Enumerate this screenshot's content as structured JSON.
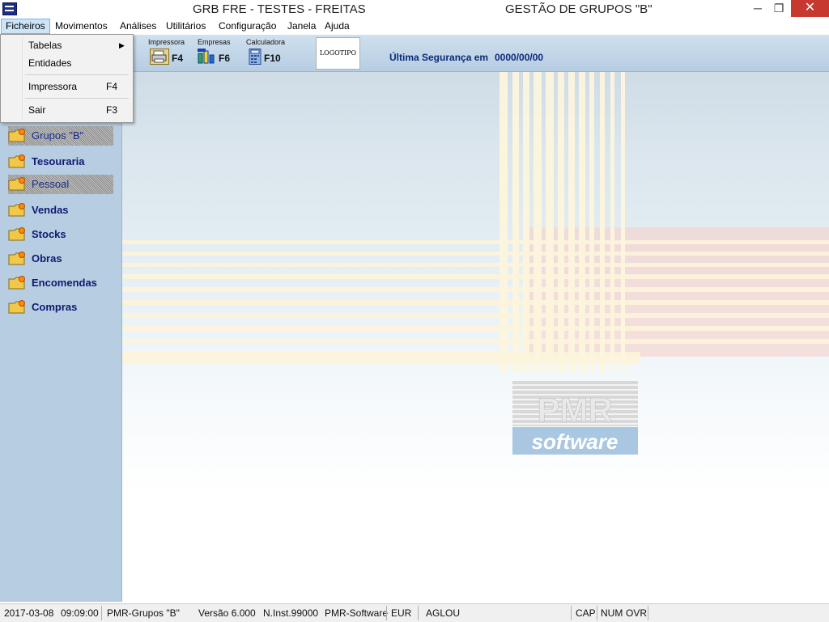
{
  "titlebar": {
    "left_title": "GRB FRE - TESTES - FREITAS",
    "right_title": "GESTÃO DE GRUPOS \"B\"",
    "minimize_glyph": "─",
    "restore_glyph": "❐",
    "close_glyph": "✕"
  },
  "menubar": {
    "items": [
      "Ficheiros",
      "Movimentos",
      "Análises",
      "Utilitários",
      "Configuração",
      "Janela",
      "Ajuda"
    ],
    "active": "Ficheiros"
  },
  "dropdown": {
    "items": [
      {
        "label": "Tabelas",
        "shortcut": "",
        "submenu": true
      },
      {
        "label": "Entidades",
        "shortcut": ""
      },
      {
        "label": "Impressora",
        "shortcut": "F4"
      },
      {
        "label": "Sair",
        "shortcut": "F3"
      }
    ],
    "submenu_arrow": "▶"
  },
  "toolbar": {
    "buttons": [
      {
        "caption": "Impressora",
        "key": "F4",
        "icon": "printer-icon"
      },
      {
        "caption": "Empresas",
        "key": "F6",
        "icon": "companies-icon"
      },
      {
        "caption": "Calculadora",
        "key": "F10",
        "icon": "calculator-icon"
      }
    ],
    "logo_text": "LOGOTIPO",
    "backup_label": "Última Segurança em",
    "backup_date": "0000/00/00"
  },
  "sidebar": {
    "items": [
      {
        "label": "Grupos \"B\"",
        "enabled": false
      },
      {
        "label": "Tesouraria",
        "enabled": true
      },
      {
        "label": "Pessoal",
        "enabled": false
      },
      {
        "label": "Vendas",
        "enabled": true
      },
      {
        "label": "Stocks",
        "enabled": true
      },
      {
        "label": "Obras",
        "enabled": true
      },
      {
        "label": "Encomendas",
        "enabled": true
      },
      {
        "label": "Compras",
        "enabled": true
      }
    ]
  },
  "brand": {
    "pmr": "PMR",
    "software": "software"
  },
  "statusbar": {
    "date": "2017-03-08",
    "time": "09:09:00",
    "app": "PMR-Grupos \"B\"",
    "version": "Versão  6.000",
    "installation": "N.Inst.99000",
    "vendor": "PMR-Software",
    "currency": "EUR",
    "user": "AGLOU",
    "caps": "CAP",
    "num": "NUM",
    "ovr": "OVR"
  },
  "colors": {
    "sidebar_bg": "#b6cde2",
    "sidebar_text": "#0f1a70",
    "close_button": "#c7392f",
    "active_menu": "#cce4f7",
    "brand_blue": "#a9c7e0"
  }
}
